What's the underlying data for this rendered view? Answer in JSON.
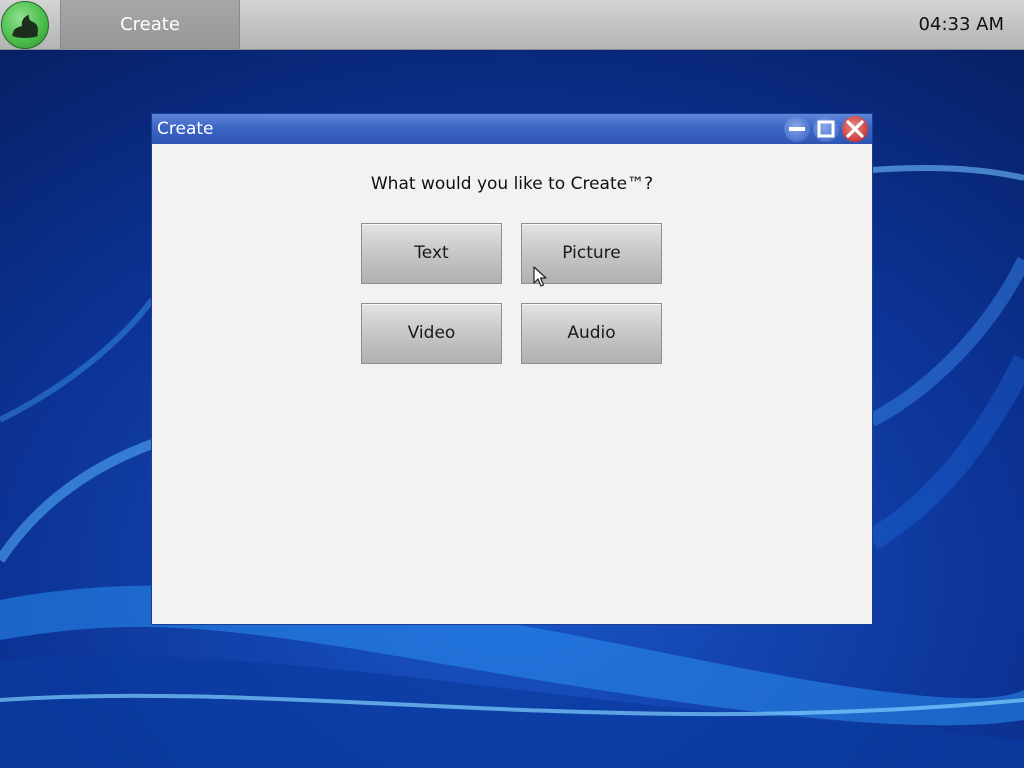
{
  "taskbar": {
    "start_icon": "app-launcher-icon",
    "task_label": "Create",
    "clock": "04:33 AM"
  },
  "window": {
    "title": "Create",
    "controls": {
      "minimize_icon": "minimize-icon",
      "maximize_icon": "maximize-icon",
      "close_icon": "close-icon"
    },
    "prompt": "What would you like to Create™?",
    "options": {
      "text": "Text",
      "picture": "Picture",
      "video": "Video",
      "audio": "Audio"
    }
  },
  "colors": {
    "titlebar": "#3c65c4",
    "close_button": "#cc3b3b",
    "desktop": "#0a2a78",
    "window_body": "#f2f2f2"
  }
}
